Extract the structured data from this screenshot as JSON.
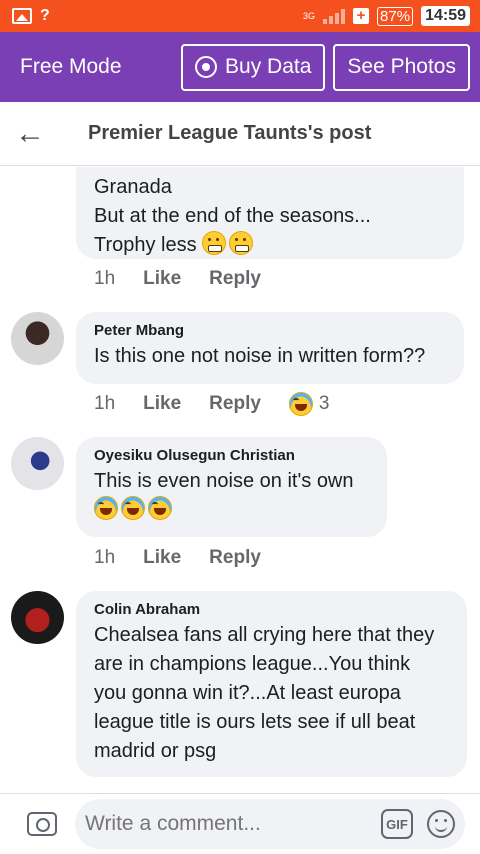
{
  "status_bar": {
    "signal_mark": "?",
    "network_label": "3G",
    "battery_percent": "87%",
    "time": "14:59"
  },
  "free_bar": {
    "label": "Free Mode",
    "buy_data_label": "Buy Data",
    "see_photos_label": "See Photos"
  },
  "header": {
    "title": "Premier League Taunts's post"
  },
  "comments": [
    {
      "name": "",
      "lines": [
        "Granada",
        "But at the end of the seasons...",
        "Trophy less"
      ],
      "emojis": [
        "grimacing-face",
        "grimacing-face"
      ],
      "time": "1h",
      "like": "Like",
      "reply": "Reply"
    },
    {
      "name": "Peter Mbang",
      "text": "Is this one not noise in written form??",
      "time": "1h",
      "like": "Like",
      "reply": "Reply",
      "reaction_count": "3",
      "reaction_emoji": "laughing-face"
    },
    {
      "name": "Oyesiku Olusegun Christian",
      "text": "This is even noise on it's own",
      "emojis": [
        "tears-of-joy",
        "tears-of-joy",
        "tears-of-joy"
      ],
      "time": "1h",
      "like": "Like",
      "reply": "Reply"
    },
    {
      "name": "Colin Abraham",
      "lines": [
        "Chealsea fans all crying here that they",
        "are in champions league...You think",
        "you gonna win it?...At least europa",
        "league title is ours lets see if ull beat",
        "madrid or psg"
      ]
    }
  ],
  "composer": {
    "placeholder": "Write a comment...",
    "gif_label": "GIF"
  },
  "colors": {
    "status_bar": "#f4511e",
    "free_bar": "#7b3fb5",
    "bubble": "#f0f2f5",
    "meta_text": "#65676b"
  }
}
